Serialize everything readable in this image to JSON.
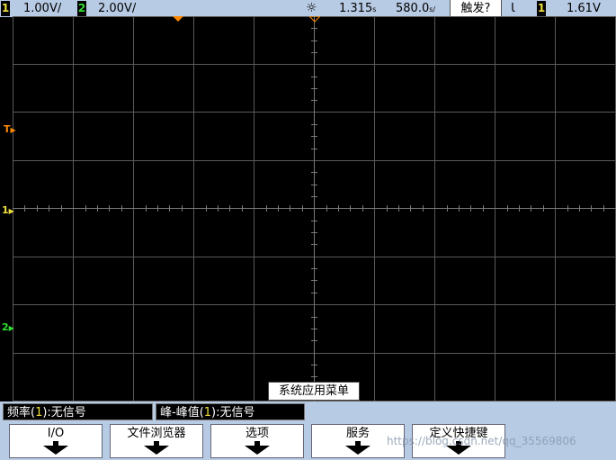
{
  "topbar": {
    "ch1_num": "1",
    "ch1_scale": "1.00V/",
    "ch2_num": "2",
    "ch2_scale": "2.00V/",
    "time_delay": "1.315",
    "time_delay_unit": "s",
    "time_scale": "580.0",
    "time_scale_unit": "s/",
    "trigger_status": "触发?",
    "trigger_slope": "Ɩ",
    "trigger_source": "1",
    "trigger_level": "1.61V"
  },
  "markers": {
    "trigger_marker": "T",
    "ch1_marker": "1",
    "ch2_marker": "2"
  },
  "popup": "系统应用菜单",
  "measurements": [
    {
      "label_prefix": "频率(",
      "channel": "1",
      "label_suffix": "):无信号"
    },
    {
      "label_prefix": "峰-峰值(",
      "channel": "1",
      "label_suffix": "):无信号"
    }
  ],
  "softkeys": [
    "I/O",
    "文件浏览器",
    "选项",
    "服务",
    "定义快捷键"
  ],
  "watermark": "https://blog.csdn.net/qq_35569806",
  "colors": {
    "ch1": "#f0e040",
    "ch2": "#30e030",
    "trigger": "#ff8800",
    "grid": "#5a5a5a"
  }
}
